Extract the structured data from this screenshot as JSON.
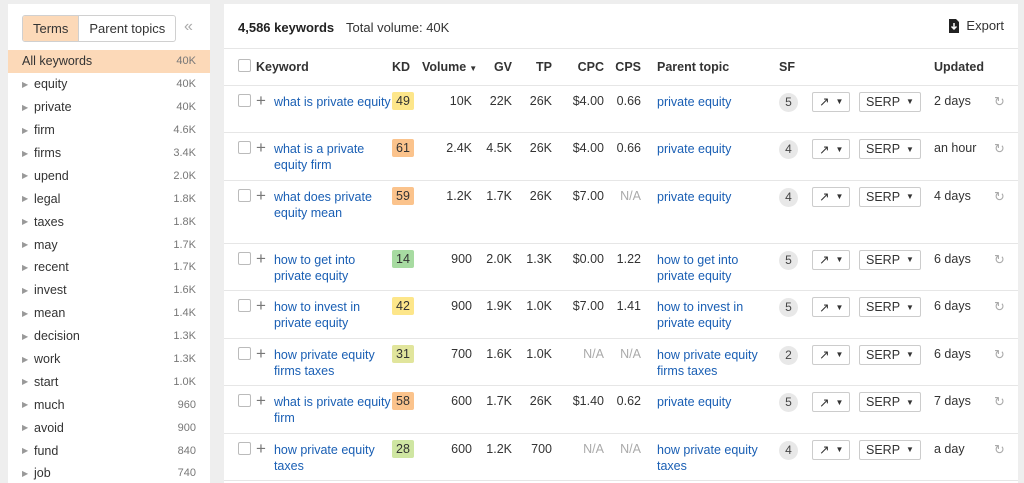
{
  "sidebar": {
    "tabs": [
      "Terms",
      "Parent topics"
    ],
    "collapse_glyph": "«",
    "items": [
      {
        "label": "All keywords",
        "count": "40K",
        "active": true
      },
      {
        "label": "equity",
        "count": "40K"
      },
      {
        "label": "private",
        "count": "40K"
      },
      {
        "label": "firm",
        "count": "4.6K"
      },
      {
        "label": "firms",
        "count": "3.4K"
      },
      {
        "label": "upend",
        "count": "2.0K"
      },
      {
        "label": "legal",
        "count": "1.8K"
      },
      {
        "label": "taxes",
        "count": "1.8K"
      },
      {
        "label": "may",
        "count": "1.7K"
      },
      {
        "label": "recent",
        "count": "1.7K"
      },
      {
        "label": "invest",
        "count": "1.6K"
      },
      {
        "label": "mean",
        "count": "1.4K"
      },
      {
        "label": "decision",
        "count": "1.3K"
      },
      {
        "label": "work",
        "count": "1.3K"
      },
      {
        "label": "start",
        "count": "1.0K"
      },
      {
        "label": "much",
        "count": "960"
      },
      {
        "label": "avoid",
        "count": "900"
      },
      {
        "label": "fund",
        "count": "840"
      },
      {
        "label": "job",
        "count": "740"
      }
    ]
  },
  "header": {
    "keyword_count": "4,586 keywords",
    "total_volume": "Total volume: 40K",
    "export_label": "Export"
  },
  "table": {
    "columns": {
      "keyword": "Keyword",
      "kd": "KD",
      "volume": "Volume",
      "gv": "GV",
      "tp": "TP",
      "cpc": "CPC",
      "cps": "CPS",
      "parent_topic": "Parent topic",
      "sf": "SF",
      "updated": "Updated"
    },
    "trend_glyph": "↗",
    "serp_label": "SERP",
    "rows": [
      {
        "keyword": "what is private equity",
        "kd": "49",
        "kd_color": "#fde68a",
        "volume": "10K",
        "gv": "22K",
        "tp": "26K",
        "cpc": "$4.00",
        "cps": "0.66",
        "parent_topic": "private equity",
        "sf": "5",
        "updated": "2 days"
      },
      {
        "keyword": "what is a private equity firm",
        "kd": "61",
        "kd_color": "#fbc38c",
        "volume": "2.4K",
        "gv": "4.5K",
        "tp": "26K",
        "cpc": "$4.00",
        "cps": "0.66",
        "parent_topic": "private equity",
        "sf": "4",
        "updated": "an hour"
      },
      {
        "keyword": "what does private equity mean",
        "kd": "59",
        "kd_color": "#fbc38c",
        "volume": "1.2K",
        "gv": "1.7K",
        "tp": "26K",
        "cpc": "$7.00",
        "cps": "N/A",
        "parent_topic": "private equity",
        "sf": "4",
        "updated": "4 days"
      },
      {
        "keyword": "how to get into private equity",
        "kd": "14",
        "kd_color": "#a7dba1",
        "volume": "900",
        "gv": "2.0K",
        "tp": "1.3K",
        "cpc": "$0.00",
        "cps": "1.22",
        "parent_topic": "how to get into private equity",
        "sf": "5",
        "updated": "6 days"
      },
      {
        "keyword": "how to invest in private equity",
        "kd": "42",
        "kd_color": "#fde68a",
        "volume": "900",
        "gv": "1.9K",
        "tp": "1.0K",
        "cpc": "$7.00",
        "cps": "1.41",
        "parent_topic": "how to invest in private equity",
        "sf": "5",
        "updated": "6 days"
      },
      {
        "keyword": "how private equity firms taxes",
        "kd": "31",
        "kd_color": "#e1e59c",
        "volume": "700",
        "gv": "1.6K",
        "tp": "1.0K",
        "cpc": "N/A",
        "cps": "N/A",
        "parent_topic": "how private equity firms taxes",
        "sf": "2",
        "updated": "6 days"
      },
      {
        "keyword": "what is private equity firm",
        "kd": "58",
        "kd_color": "#fbc38c",
        "volume": "600",
        "gv": "1.7K",
        "tp": "26K",
        "cpc": "$1.40",
        "cps": "0.62",
        "parent_topic": "private equity",
        "sf": "5",
        "updated": "7 days"
      },
      {
        "keyword": "how private equity taxes",
        "kd": "28",
        "kd_color": "#cfe6a2",
        "volume": "600",
        "gv": "1.2K",
        "tp": "700",
        "cpc": "N/A",
        "cps": "N/A",
        "parent_topic": "how private equity taxes",
        "sf": "4",
        "updated": "a day"
      }
    ]
  }
}
